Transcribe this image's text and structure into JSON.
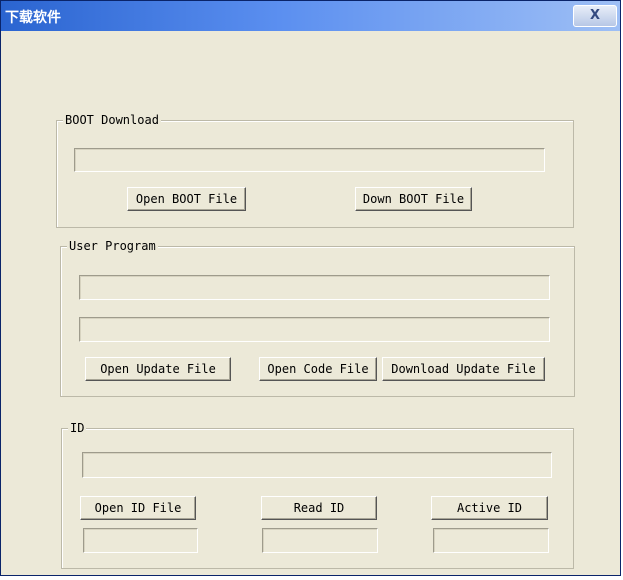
{
  "window": {
    "title": "下载软件",
    "close_label": "X"
  },
  "boot": {
    "legend": "BOOT Download",
    "path_value": "",
    "open_label": "Open BOOT File",
    "down_label": "Down BOOT File"
  },
  "user": {
    "legend": "User Program",
    "update_path_value": "",
    "code_path_value": "",
    "open_update_label": "Open Update File",
    "open_code_label": "Open Code File",
    "download_update_label": "Download Update File"
  },
  "id": {
    "legend": "ID",
    "path_value": "",
    "open_label": "Open ID File",
    "read_label": "Read ID",
    "active_label": "Active ID",
    "open_result": "",
    "read_result": "",
    "active_result": ""
  }
}
